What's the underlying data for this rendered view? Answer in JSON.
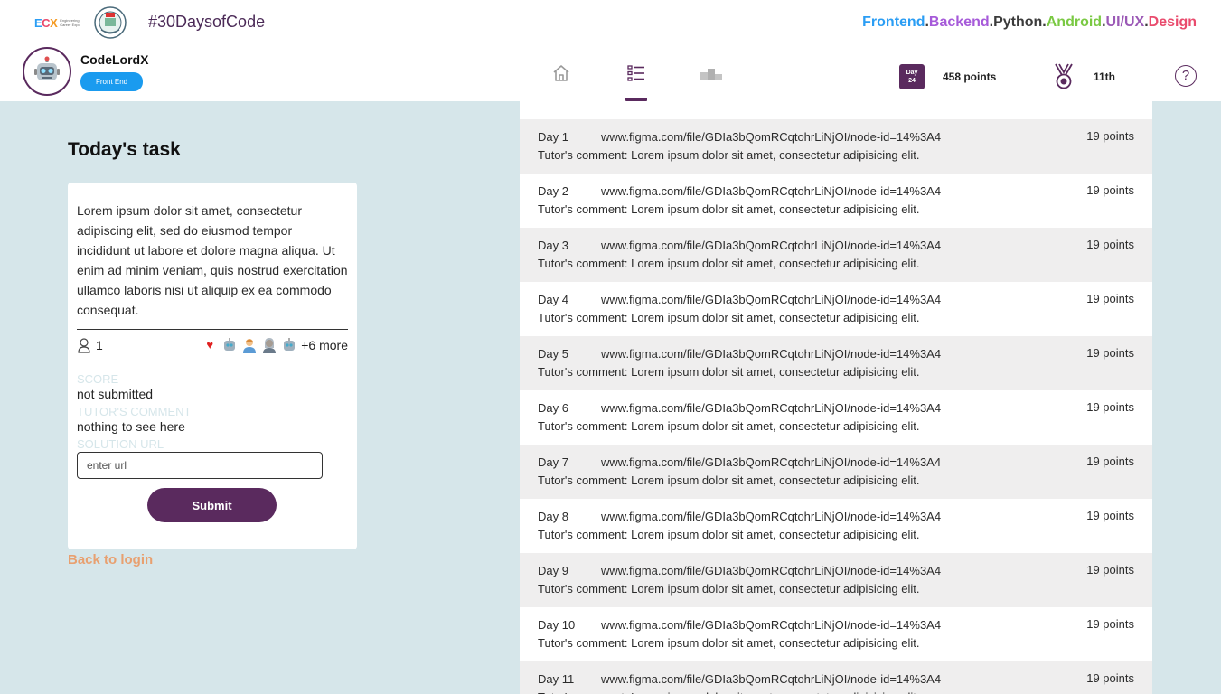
{
  "brand": {
    "ecx_letters": [
      "E",
      "C",
      "X"
    ],
    "ecx_subtitle": "Engineering Career Expo",
    "hashtag": "#30DaysofCode",
    "tracks": [
      "Frontend",
      "Backend",
      "Python",
      "Android",
      "UI/UX",
      "Design"
    ]
  },
  "profile": {
    "username": "CodeLordX",
    "track": "Front End"
  },
  "nav": {
    "items": [
      {
        "name": "home",
        "icon": "home-icon",
        "active": false
      },
      {
        "name": "tasks",
        "icon": "task-list-icon",
        "active": true
      },
      {
        "name": "leaderboard",
        "icon": "podium-icon",
        "active": false
      }
    ]
  },
  "stats": {
    "day_label": "Day",
    "day_number": "24",
    "points": "458 points",
    "rank": "11th",
    "help": "?"
  },
  "task": {
    "title": "Today's task",
    "description": "Lorem ipsum dolor sit amet, consectetur adipiscing elit, sed do eiusmod tempor incididunt ut labore et dolore magna aliqua. Ut enim ad minim veniam, quis nostrud exercitation ullamco laboris nisi ut aliquip ex ea commodo consequat.",
    "submissions_count": "1",
    "reactions_more": "+6 more",
    "score_label": "SCORE",
    "score_value": "not submitted",
    "comment_label": "TUTOR'S COMMENT",
    "comment_value": "nothing to see here",
    "url_label": "SOLUTION URL",
    "url_placeholder": "enter url",
    "submit_label": "Submit",
    "back_label": "Back to login"
  },
  "colors": {
    "primary": "#5a2a5e",
    "background": "#d6e6ea",
    "badge": "#1a9bef",
    "link": "#e8a070"
  },
  "submissions": [
    {
      "day": "Day 1",
      "url": "www.figma.com/file/GDIa3bQomRCqtohrLiNjOI/node-id=14%3A4",
      "points": "19 points",
      "comment": "Tutor's comment: Lorem ipsum dolor sit amet, consectetur adipisicing elit."
    },
    {
      "day": "Day 2",
      "url": "www.figma.com/file/GDIa3bQomRCqtohrLiNjOI/node-id=14%3A4",
      "points": "19 points",
      "comment": "Tutor's comment: Lorem ipsum dolor sit amet, consectetur adipisicing elit."
    },
    {
      "day": "Day 3",
      "url": "www.figma.com/file/GDIa3bQomRCqtohrLiNjOI/node-id=14%3A4",
      "points": "19 points",
      "comment": "Tutor's comment: Lorem ipsum dolor sit amet, consectetur adipisicing elit."
    },
    {
      "day": "Day 4",
      "url": "www.figma.com/file/GDIa3bQomRCqtohrLiNjOI/node-id=14%3A4",
      "points": "19 points",
      "comment": "Tutor's comment: Lorem ipsum dolor sit amet, consectetur adipisicing elit."
    },
    {
      "day": "Day 5",
      "url": "www.figma.com/file/GDIa3bQomRCqtohrLiNjOI/node-id=14%3A4",
      "points": "19 points",
      "comment": "Tutor's comment: Lorem ipsum dolor sit amet, consectetur adipisicing elit."
    },
    {
      "day": "Day 6",
      "url": "www.figma.com/file/GDIa3bQomRCqtohrLiNjOI/node-id=14%3A4",
      "points": "19 points",
      "comment": "Tutor's comment: Lorem ipsum dolor sit amet, consectetur adipisicing elit."
    },
    {
      "day": "Day 7",
      "url": "www.figma.com/file/GDIa3bQomRCqtohrLiNjOI/node-id=14%3A4",
      "points": "19 points",
      "comment": "Tutor's comment: Lorem ipsum dolor sit amet, consectetur adipisicing elit."
    },
    {
      "day": "Day 8",
      "url": "www.figma.com/file/GDIa3bQomRCqtohrLiNjOI/node-id=14%3A4",
      "points": "19 points",
      "comment": "Tutor's comment: Lorem ipsum dolor sit amet, consectetur adipisicing elit."
    },
    {
      "day": "Day 9",
      "url": "www.figma.com/file/GDIa3bQomRCqtohrLiNjOI/node-id=14%3A4",
      "points": "19 points",
      "comment": "Tutor's comment: Lorem ipsum dolor sit amet, consectetur adipisicing elit."
    },
    {
      "day": "Day 10",
      "url": "www.figma.com/file/GDIa3bQomRCqtohrLiNjOI/node-id=14%3A4",
      "points": "19 points",
      "comment": "Tutor's comment: Lorem ipsum dolor sit amet, consectetur adipisicing elit."
    },
    {
      "day": "Day 11",
      "url": "www.figma.com/file/GDIa3bQomRCqtohrLiNjOI/node-id=14%3A4",
      "points": "19 points",
      "comment": "Tutor's comment: Lorem ipsum dolor sit amet, consectetur adipisicing elit."
    }
  ]
}
